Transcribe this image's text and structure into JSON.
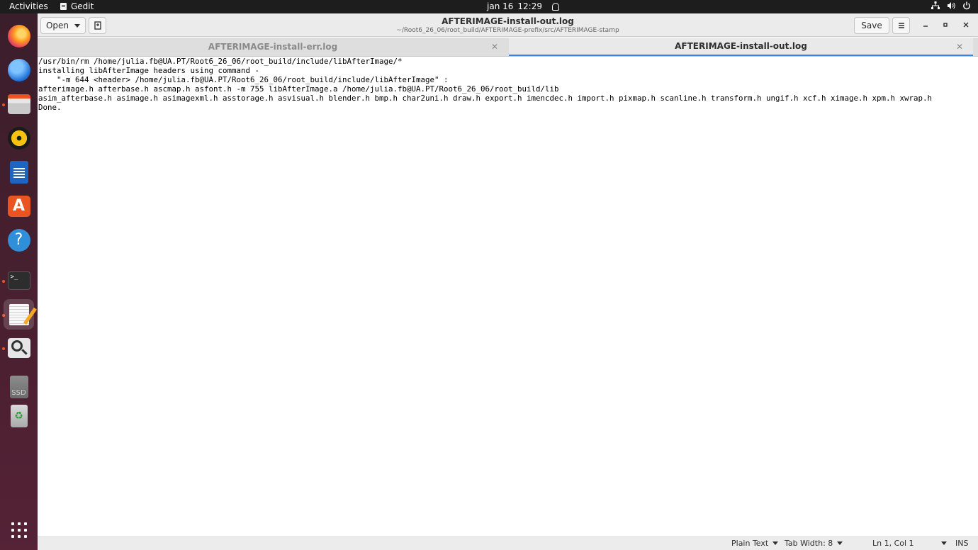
{
  "topbar": {
    "activities": "Activities",
    "app_name": "Gedit",
    "date": "jan 16",
    "time": "12:29"
  },
  "dock": {
    "items": [
      {
        "name": "firefox-icon"
      },
      {
        "name": "thunderbird-icon"
      },
      {
        "name": "files-icon"
      },
      {
        "name": "rhythmbox-icon"
      },
      {
        "name": "libreoffice-writer-icon"
      },
      {
        "name": "ubuntu-software-icon"
      },
      {
        "name": "help-icon"
      },
      {
        "name": "terminal-icon"
      },
      {
        "name": "text-editor-icon"
      },
      {
        "name": "image-viewer-icon"
      },
      {
        "name": "ssd-drive-icon",
        "label": "SSD"
      },
      {
        "name": "trash-icon"
      }
    ]
  },
  "headerbar": {
    "open_label": "Open",
    "title": "AFTERIMAGE-install-out.log",
    "subtitle": "~/Root6_26_06/root_build/AFTERIMAGE-prefix/src/AFTERIMAGE-stamp",
    "save_label": "Save"
  },
  "tabs": [
    {
      "label": "AFTERIMAGE-install-err.log",
      "active": false
    },
    {
      "label": "AFTERIMAGE-install-out.log",
      "active": true
    }
  ],
  "document": {
    "lines": [
      "/usr/bin/rm /home/julia.fb@UA.PT/Root6_26_06/root_build/include/libAfterImage/*",
      "installing libAfterImage headers using command -",
      "    \"-m 644 <header> /home/julia.fb@UA.PT/Root6_26_06/root_build/include/libAfterImage\" :",
      "afterimage.h afterbase.h ascmap.h asfont.h -m 755 libAfterImage.a /home/julia.fb@UA.PT/Root6_26_06/root_build/lib",
      "asim_afterbase.h asimage.h asimagexml.h asstorage.h asvisual.h blender.h bmp.h char2uni.h draw.h export.h imencdec.h import.h pixmap.h scanline.h transform.h ungif.h xcf.h ximage.h xpm.h xwrap.h",
      "Done."
    ]
  },
  "statusbar": {
    "language": "Plain Text",
    "tab_width": "Tab Width: 8",
    "position": "Ln 1, Col 1",
    "mode": "INS"
  },
  "colors": {
    "accent": "#3584e4",
    "ubuntu_orange": "#e95420",
    "topbar_bg": "#1d1d1d"
  }
}
